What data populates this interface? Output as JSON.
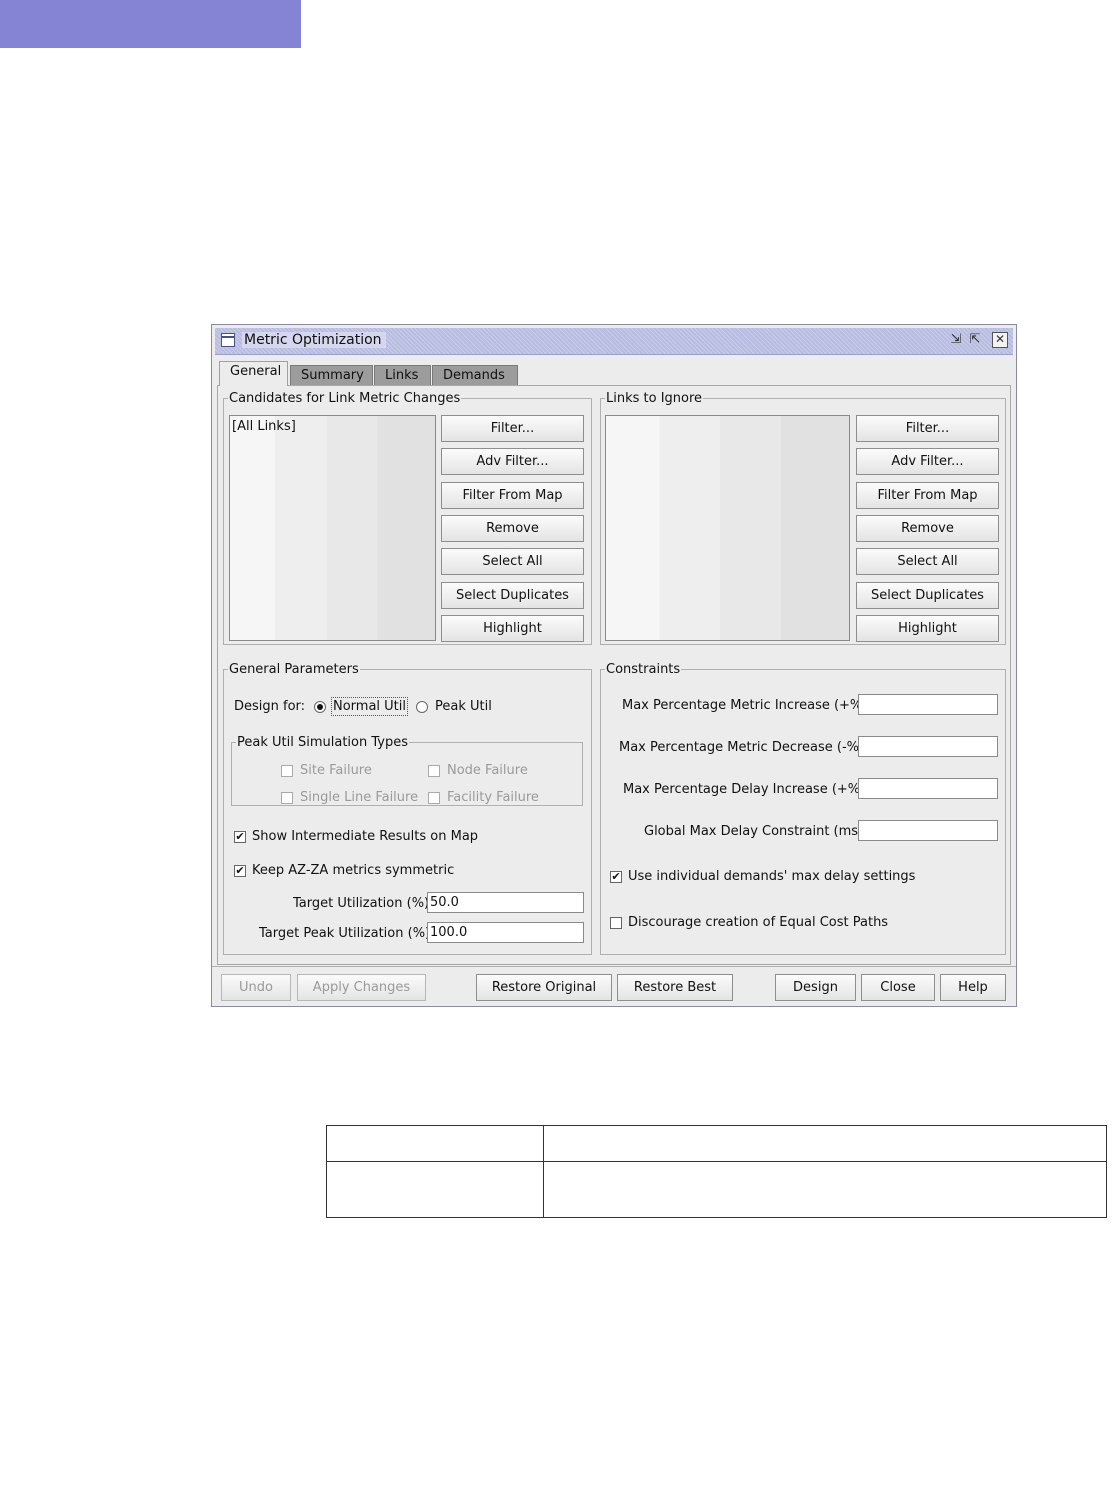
{
  "window": {
    "title": "Metric Optimization"
  },
  "tabs": [
    "General",
    "Summary",
    "Links",
    "Demands"
  ],
  "candidates": {
    "legend": "Candidates for Link Metric Changes",
    "list_items": [
      "[All Links]"
    ],
    "buttons": [
      "Filter...",
      "Adv Filter...",
      "Filter From Map",
      "Remove",
      "Select All",
      "Select Duplicates",
      "Highlight"
    ]
  },
  "ignore": {
    "legend": "Links to Ignore",
    "buttons": [
      "Filter...",
      "Adv Filter...",
      "Filter From Map",
      "Remove",
      "Select All",
      "Select Duplicates",
      "Highlight"
    ]
  },
  "general_params": {
    "legend": "General Parameters",
    "design_for_label": "Design for:",
    "radio_normal": "Normal Util",
    "radio_peak": "Peak Util",
    "selected": "Normal Util",
    "sim_types": {
      "legend": "Peak Util Simulation Types",
      "site_failure": "Site Failure",
      "node_failure": "Node Failure",
      "single_line_failure": "Single Line Failure",
      "facility_failure": "Facility Failure"
    },
    "show_intermediate": {
      "label": "Show Intermediate Results on Map",
      "checked": true
    },
    "keep_symmetric": {
      "label": "Keep AZ-ZA metrics symmetric",
      "checked": true
    },
    "target_util": {
      "label": "Target Utilization (%):",
      "value": "50.0"
    },
    "target_peak_util": {
      "label": "Target Peak Utilization (%):",
      "value": "100.0"
    }
  },
  "constraints": {
    "legend": "Constraints",
    "max_metric_increase": {
      "label": "Max Percentage Metric Increase (+%):",
      "value": ""
    },
    "max_metric_decrease": {
      "label": "Max Percentage Metric Decrease (-%):",
      "value": ""
    },
    "max_delay_increase": {
      "label": "Max Percentage Delay Increase (+%):",
      "value": ""
    },
    "global_max_delay": {
      "label": "Global Max Delay Constraint (ms):",
      "value": ""
    },
    "use_individual": {
      "label": "Use individual demands' max delay settings",
      "checked": true
    },
    "discourage_ecmp": {
      "label": "Discourage creation of Equal Cost Paths",
      "checked": false
    }
  },
  "footer": {
    "undo": "Undo",
    "apply": "Apply Changes",
    "restore_original": "Restore Original",
    "restore_best": "Restore Best",
    "design": "Design",
    "close": "Close",
    "help": "Help"
  },
  "colors": {
    "header_bar": "#8583d4",
    "window_bg": "#ececec",
    "titlebar": "#c9cdea"
  }
}
